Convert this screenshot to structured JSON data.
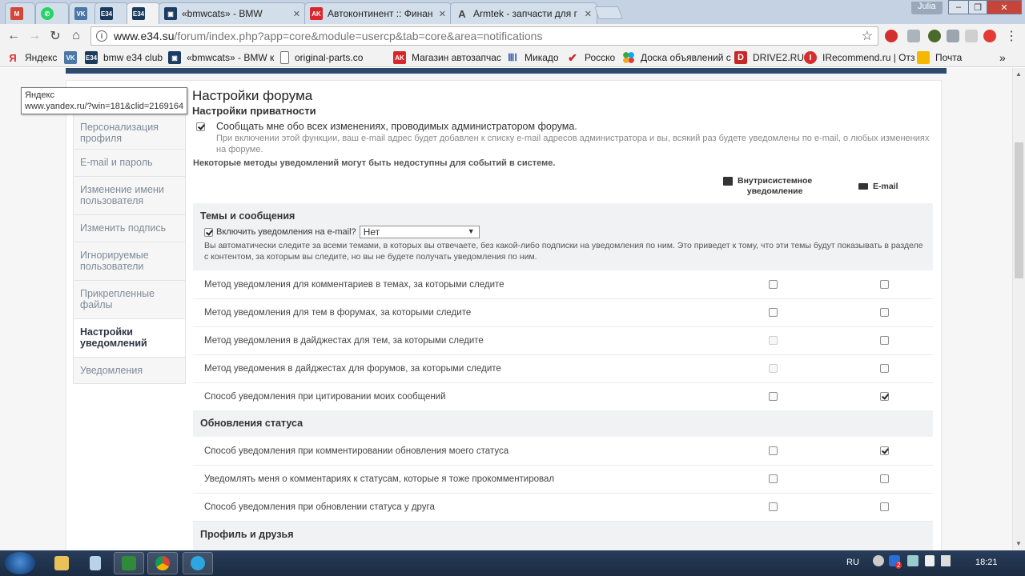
{
  "browser": {
    "tabs": [
      {
        "title": "",
        "favicon": "gmail-icon",
        "color": "#d44638"
      },
      {
        "title": "",
        "favicon": "whatsapp-icon",
        "color": "#25d366"
      },
      {
        "title": "",
        "favicon": "vk-icon",
        "color": "#4a76a8"
      },
      {
        "title": "",
        "favicon": "e34-icon",
        "color": "#1b3a5c"
      },
      {
        "title": "",
        "favicon": "e34-icon",
        "color": "#1b3a5c"
      },
      {
        "title": "«bmwcats» - BMW",
        "favicon": "bmwcats-icon",
        "color": "#1d3c63"
      },
      {
        "title": "Автоконтинент :: Финан",
        "favicon": "ak-icon",
        "color": "#d8262c"
      },
      {
        "title": "Armtek - запчасти для г",
        "favicon": "armtek-icon",
        "color": "#444444"
      }
    ],
    "profile_name": "Julia",
    "url_host": "www.e34.su",
    "url_path": "/forum/index.php?app=core&module=usercp&tab=core&area=notifications",
    "bookmarks": [
      {
        "label": "Яндекс",
        "favicon": "yandex-icon",
        "color": "#e02f2f"
      },
      {
        "label": "",
        "favicon": "vk-icon",
        "color": "#4a76a8"
      },
      {
        "label": "bmw e34 club",
        "favicon": "e34-icon",
        "color": "#1b3a5c"
      },
      {
        "label": "«bmwcats» - BMW к",
        "favicon": "bmwcats-icon",
        "color": "#1d3c63"
      },
      {
        "label": "original-parts.co",
        "favicon": "page-icon",
        "color": "#ffffff"
      },
      {
        "label": "Магазин автозапчас",
        "favicon": "ak-icon",
        "color": "#d8262c"
      },
      {
        "label": "Микадо",
        "favicon": "mikado-icon",
        "color": "#2a5aa8"
      },
      {
        "label": "Росско",
        "favicon": "rossko-icon",
        "color": "#c62828"
      },
      {
        "label": "Доска объявлений с",
        "favicon": "avito-icon",
        "color": "#39a845"
      },
      {
        "label": "DRIVE2.RU",
        "favicon": "drive2-icon",
        "color": "#c62828"
      },
      {
        "label": "IRecommend.ru | Отз",
        "favicon": "irecommend-icon",
        "color": "#d32f2f"
      },
      {
        "label": "Почта",
        "favicon": "mail-icon",
        "color": "#f5b800"
      }
    ]
  },
  "tooltip": {
    "line1": "Яндекс",
    "line2": "www.yandex.ru/?win=181&clid=2169164"
  },
  "sidebar": {
    "items": [
      {
        "label": "Персонализация профиля",
        "active": false
      },
      {
        "label": "E-mail и пароль",
        "active": false
      },
      {
        "label": "Изменение имени пользователя",
        "active": false
      },
      {
        "label": "Изменить подпись",
        "active": false
      },
      {
        "label": "Игнорируемые пользователи",
        "active": false
      },
      {
        "label": "Прикрепленные файлы",
        "active": false
      },
      {
        "label": "Настройки уведомлений",
        "active": true
      },
      {
        "label": "Уведомления",
        "active": false
      }
    ]
  },
  "main": {
    "title": "Настройки форума",
    "privacy_heading": "Настройки приватности",
    "privacy_option_label": "Сообщать мне обо всех изменениях, проводимых администратором форума.",
    "privacy_option_desc": "При включении этой функции, ваш e-mail адрес будет добавлен к списку e-mail адресов администратора и вы, всякий раз будете уведомлены по e-mail, о любых изменениях на форуме.",
    "privacy_checked": true,
    "warning": "Некоторые методы уведомлений могут быть недоступны для событий в системе.",
    "col_inline_line1": "Внутрисистемное",
    "col_inline_line2": "уведомление",
    "col_email": "E-mail",
    "topics_section": {
      "title": "Темы и сообщения",
      "enable_label": "Включить уведомления на e-mail?",
      "enable_checked": true,
      "select_value": "Нет",
      "auto_text": "Вы автоматически следите за всеми темами, в которых вы отвечаете, без какой-либо подписки на уведомления по ним. Это приведет к тому, что эти темы будут показывать в разделе с контентом, за которым вы следите, но вы не будете получать уведомления по ним."
    },
    "topic_rows": [
      {
        "label": "Метод уведомления для комментариев в темах, за которыми следите",
        "inline": false,
        "inline_disabled": false,
        "email": false
      },
      {
        "label": "Метод уведомления для тем в форумах, за которыми следите",
        "inline": false,
        "inline_disabled": false,
        "email": false
      },
      {
        "label": "Метод уведомления в дайджестах для тем, за которыми следите",
        "inline": false,
        "inline_disabled": true,
        "email": false
      },
      {
        "label": "Метод уведомения в дайджестах для форумов, за которыми следите",
        "inline": false,
        "inline_disabled": true,
        "email": false
      },
      {
        "label": "Способ уведомления при цитировании моих сообщений",
        "inline": false,
        "inline_disabled": false,
        "email": true
      }
    ],
    "status_section_title": "Обновления статуса",
    "status_rows": [
      {
        "label": "Способ уведомления при комментировании обновления моего статуса",
        "inline": false,
        "inline_disabled": false,
        "email": true
      },
      {
        "label": "Уведомлять меня о комментариях к статусам, которые я тоже прокомментировал",
        "inline": false,
        "inline_disabled": false,
        "email": false
      },
      {
        "label": "Способ уведомления при обновлении статуса у друга",
        "inline": false,
        "inline_disabled": false,
        "email": false
      }
    ],
    "profile_section_title": "Профиль и друзья"
  },
  "taskbar": {
    "lang": "RU",
    "time": "18:21",
    "badge": "2"
  }
}
